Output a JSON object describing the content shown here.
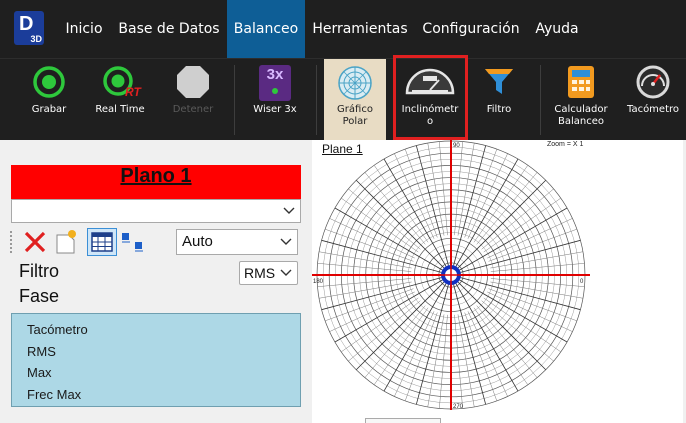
{
  "app": {
    "logo_letter": "D",
    "logo_sub": "3D"
  },
  "menu": {
    "items": [
      {
        "label": "Inicio"
      },
      {
        "label": "Base de Datos"
      },
      {
        "label": "Balanceo",
        "active": true
      },
      {
        "label": "Herramientas"
      },
      {
        "label": "Configuración"
      },
      {
        "label": "Ayuda"
      }
    ]
  },
  "ribbon": {
    "grabar": {
      "label": "Grabar",
      "icon": "record-icon"
    },
    "realtime": {
      "label": "Real Time",
      "icon": "realtime-icon",
      "badge": "RT"
    },
    "detener": {
      "label": "Detener",
      "icon": "stop-icon",
      "disabled": true
    },
    "wiser": {
      "label": "Wiser 3x",
      "icon": "wiser-icon",
      "badge": "3x"
    },
    "grafico": {
      "label_line1": "Gráfico",
      "label_line2": "Polar",
      "icon": "polar-chart-icon",
      "selected": true
    },
    "inclinometro": {
      "label_line1": "Inclinómetr",
      "label_line2": "o",
      "icon": "inclinometer-icon",
      "highlighted": true
    },
    "filtro": {
      "label": "Filtro",
      "icon": "funnel-icon"
    },
    "calculador": {
      "label_line1": "Calculador",
      "label_line2": "Balanceo",
      "icon": "calculator-icon"
    },
    "tacometro": {
      "label": "Tacómetro",
      "icon": "tachometer-icon"
    }
  },
  "left_panel": {
    "plano_title": "Plano 1",
    "plano_color": "#ff0000",
    "combo_value": "",
    "auto_value": "Auto",
    "filtro_label": "Filtro",
    "fase_label": "Fase",
    "rms_value": "RMS",
    "measures": [
      "Tacómetro",
      "RMS",
      "Max",
      "Frec Max"
    ]
  },
  "plot": {
    "title": "Plane 1",
    "zoom": "Zoom = X 1",
    "angle_top": "90",
    "angle_left": "180",
    "angle_right": "0",
    "angle_bottom": "270"
  },
  "colors": {
    "menu_bg": "#1f1f1f",
    "menu_active": "#0e5e96",
    "highlight_red": "#e02020",
    "list_bg": "#add8e6",
    "axis_red": "#e00000",
    "center_blue": "#1030c0"
  }
}
